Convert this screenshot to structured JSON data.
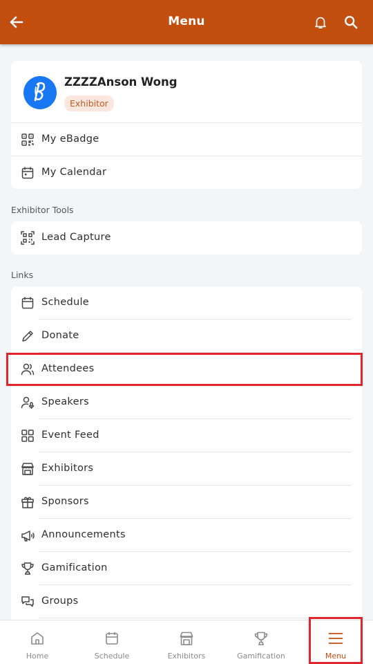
{
  "header": {
    "title": "Menu"
  },
  "profile": {
    "name": "ZZZZAnson Wong",
    "role": "Exhibitor",
    "items": [
      {
        "label": "My eBadge",
        "icon": "qr-badge-icon"
      },
      {
        "label": "My Calendar",
        "icon": "calendar-icon"
      }
    ]
  },
  "exhibitor_tools": {
    "heading": "Exhibitor Tools",
    "items": [
      {
        "label": "Lead Capture",
        "icon": "qr-scan-icon"
      }
    ]
  },
  "links": {
    "heading": "Links",
    "items": [
      {
        "label": "Schedule",
        "icon": "calendar-icon"
      },
      {
        "label": "Donate",
        "icon": "pencil-icon"
      },
      {
        "label": "Attendees",
        "icon": "users-icon"
      },
      {
        "label": "Speakers",
        "icon": "speaker-icon"
      },
      {
        "label": "Event Feed",
        "icon": "grid-icon"
      },
      {
        "label": "Exhibitors",
        "icon": "storefront-icon"
      },
      {
        "label": "Sponsors",
        "icon": "gift-icon"
      },
      {
        "label": "Announcements",
        "icon": "megaphone-icon"
      },
      {
        "label": "Gamification",
        "icon": "trophy-icon"
      },
      {
        "label": "Groups",
        "icon": "chat-bubbles-icon"
      }
    ]
  },
  "bottom_nav": {
    "items": [
      {
        "label": "Home",
        "icon": "home-icon"
      },
      {
        "label": "Schedule",
        "icon": "calendar-icon"
      },
      {
        "label": "Exhibitors",
        "icon": "storefront-icon"
      },
      {
        "label": "Gamification",
        "icon": "trophy-icon"
      },
      {
        "label": "Menu",
        "icon": "hamburger-icon"
      }
    ],
    "active": "Menu"
  },
  "colors": {
    "primary": "#c24f10",
    "highlight": "#e0252d",
    "badge_bg": "#fbe7de",
    "badge_text": "#c65a23",
    "avatar_bg": "#1877f2"
  }
}
